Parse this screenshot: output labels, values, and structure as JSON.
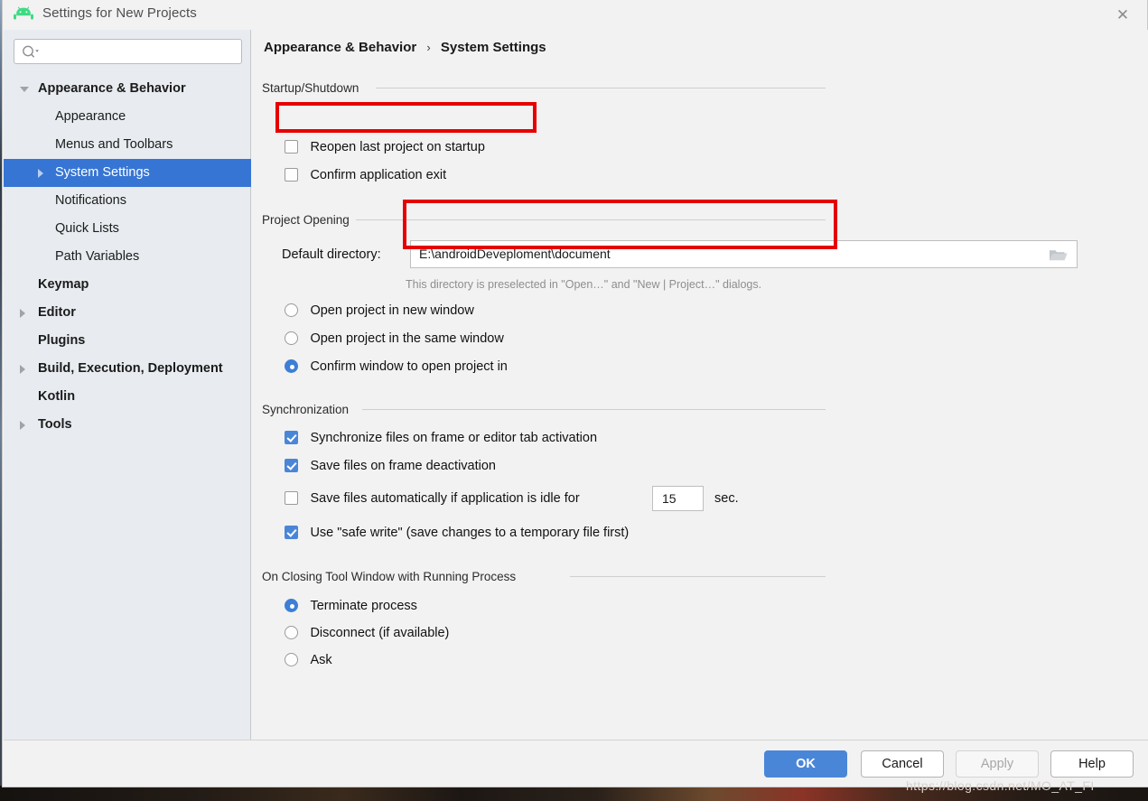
{
  "window": {
    "title": "Settings for New Projects",
    "app_icon": "android-icon",
    "close_icon": "✕"
  },
  "sidebar": {
    "search": {
      "placeholder": "",
      "value": "",
      "icon": "search-icon"
    },
    "items": [
      {
        "label": "Appearance & Behavior",
        "depth": 0,
        "arrow": "expanded",
        "selected": false
      },
      {
        "label": "Appearance",
        "depth": 1,
        "arrow": "none",
        "selected": false
      },
      {
        "label": "Menus and Toolbars",
        "depth": 1,
        "arrow": "none",
        "selected": false
      },
      {
        "label": "System Settings",
        "depth": 1,
        "arrow": "collapsed",
        "selected": true
      },
      {
        "label": "Notifications",
        "depth": 1,
        "arrow": "none",
        "selected": false
      },
      {
        "label": "Quick Lists",
        "depth": 1,
        "arrow": "none",
        "selected": false
      },
      {
        "label": "Path Variables",
        "depth": 1,
        "arrow": "none",
        "selected": false
      },
      {
        "label": "Keymap",
        "depth": 0,
        "arrow": "none",
        "selected": false
      },
      {
        "label": "Editor",
        "depth": 0,
        "arrow": "collapsed",
        "selected": false
      },
      {
        "label": "Plugins",
        "depth": 0,
        "arrow": "none",
        "selected": false
      },
      {
        "label": "Build, Execution, Deployment",
        "depth": 0,
        "arrow": "collapsed",
        "selected": false
      },
      {
        "label": "Kotlin",
        "depth": 0,
        "arrow": "none",
        "selected": false
      },
      {
        "label": "Tools",
        "depth": 0,
        "arrow": "collapsed",
        "selected": false
      }
    ]
  },
  "breadcrumb": {
    "root": "Appearance & Behavior",
    "separator": "›",
    "leaf": "System Settings"
  },
  "sections": {
    "startup": {
      "title": "Startup/Shutdown",
      "reopen_last_project": {
        "label": "Reopen last project on startup",
        "checked": false
      },
      "confirm_exit": {
        "label": "Confirm application exit",
        "checked": false
      }
    },
    "project_opening": {
      "title": "Project Opening",
      "default_directory_label": "Default directory:",
      "default_directory_value": "E:\\androidDeveploment\\document",
      "browse_icon": "folder-icon",
      "hint": "This directory is preselected in \"Open…\" and \"New | Project…\" dialogs.",
      "options": [
        {
          "label": "Open project in new window",
          "selected": false
        },
        {
          "label": "Open project in the same window",
          "selected": false
        },
        {
          "label": "Confirm window to open project in",
          "selected": true
        }
      ]
    },
    "synchronization": {
      "title": "Synchronization",
      "sync_on_activation": {
        "label": "Synchronize files on frame or editor tab activation",
        "checked": true
      },
      "save_on_deactivation": {
        "label": "Save files on frame deactivation",
        "checked": true
      },
      "autosave_idle": {
        "label": "Save files automatically if application is idle for",
        "checked": false,
        "value": "15",
        "unit": "sec."
      },
      "safe_write": {
        "label": "Use \"safe write\" (save changes to a temporary file first)",
        "checked": true
      }
    },
    "closing_tool_window": {
      "title": "On Closing Tool Window with Running Process",
      "options": [
        {
          "label": "Terminate process",
          "selected": true
        },
        {
          "label": "Disconnect (if available)",
          "selected": false
        },
        {
          "label": "Ask",
          "selected": false
        }
      ]
    }
  },
  "footer": {
    "ok": "OK",
    "cancel": "Cancel",
    "apply": "Apply",
    "help": "Help"
  },
  "watermark": "https://blog.csdn.net/MO_AT_FI",
  "colors": {
    "accent": "#3675d3",
    "button_primary": "#4a86d8",
    "highlight_box": "#e60000",
    "sidebar_bg": "#e8ecf0",
    "panel_bg": "#f2f2f2"
  }
}
